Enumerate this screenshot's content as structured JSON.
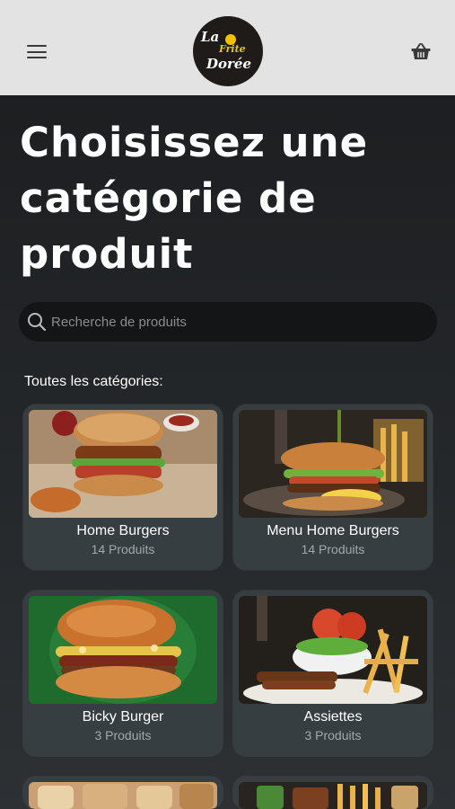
{
  "header": {
    "logo": {
      "line1": "La",
      "line2": "Frite",
      "line3": "Dorée"
    }
  },
  "page": {
    "title": "Choisissez une catégorie de produit"
  },
  "search": {
    "placeholder": "Recherche de produits"
  },
  "categories_label": "Toutes les catégories:",
  "categories": [
    {
      "name": "Home Burgers",
      "count": "14 Produits"
    },
    {
      "name": "Menu Home Burgers",
      "count": "14 Produits"
    },
    {
      "name": "Bicky Burger",
      "count": "3 Produits"
    },
    {
      "name": "Assiettes",
      "count": "3 Produits"
    }
  ],
  "icons": {
    "menu": "hamburger-menu-icon",
    "cart": "basket-icon",
    "search": "search-icon"
  },
  "colors": {
    "header_bg": "#e3e3e3",
    "card_bg": "#373e42",
    "logo_accent": "#f2c200",
    "muted_text": "#a3a8ab"
  }
}
